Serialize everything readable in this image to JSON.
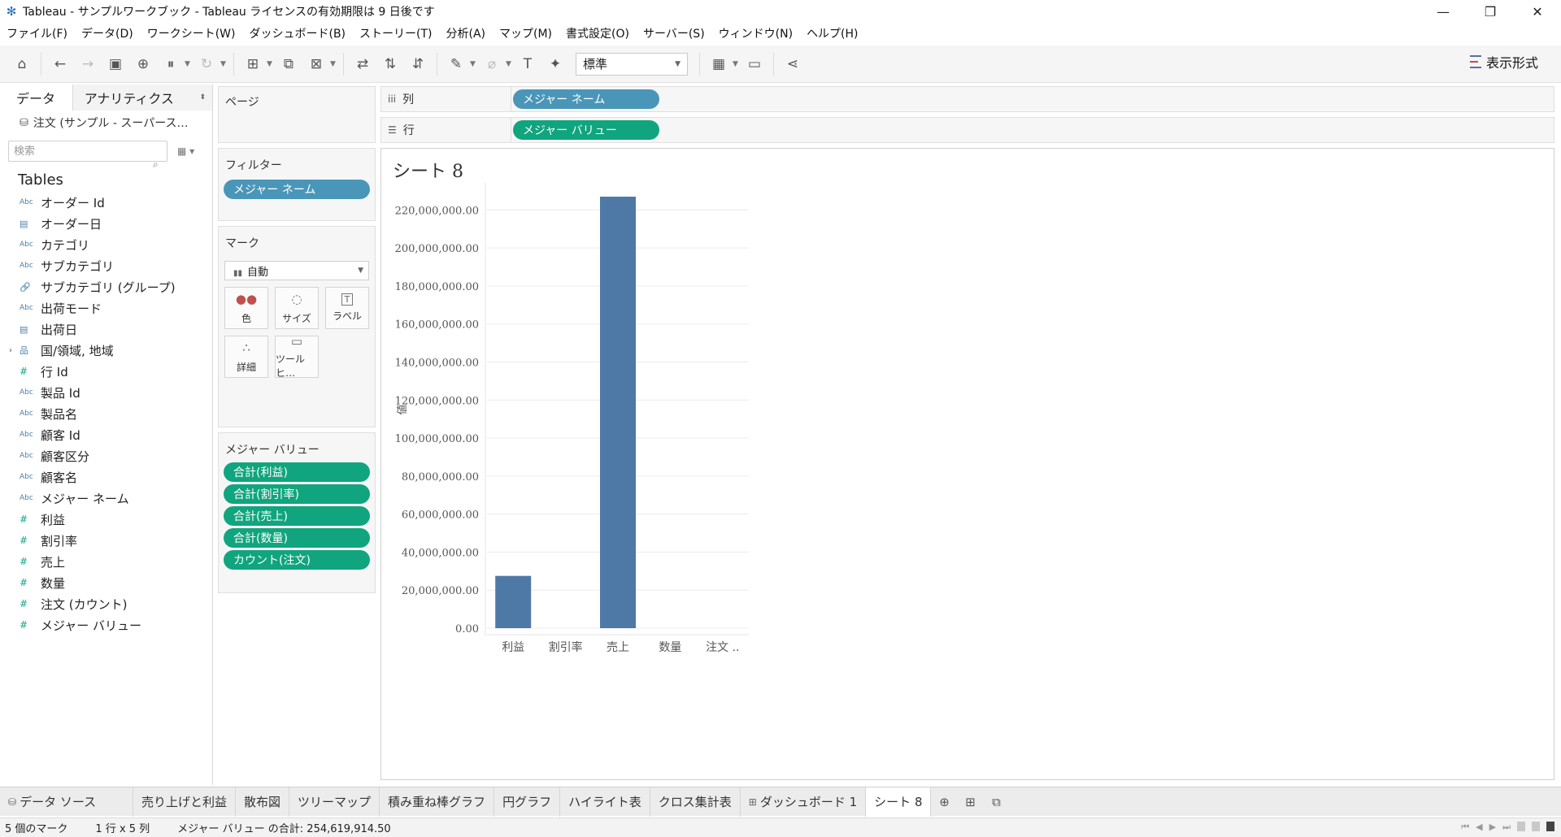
{
  "window": {
    "title": "Tableau - サンプルワークブック - Tableau ライセンスの有効期限は 9 日後です",
    "minimize": "—",
    "restore": "❐",
    "close": "✕"
  },
  "menu": [
    "ファイル(F)",
    "データ(D)",
    "ワークシート(W)",
    "ダッシュボード(B)",
    "ストーリー(T)",
    "分析(A)",
    "マップ(M)",
    "書式設定(O)",
    "サーバー(S)",
    "ウィンドウ(N)",
    "ヘルプ(H)"
  ],
  "toolbar": {
    "fit_value": "標準",
    "show_me_label": "表示形式"
  },
  "data_pane": {
    "tab_data": "データ",
    "tab_analytics": "アナリティクス",
    "datasource": "注文 (サンプル - スーパース…",
    "search_placeholder": "検索",
    "tables_heading": "Tables",
    "fields": [
      {
        "type": "Abc",
        "kind": "str",
        "name": "オーダー Id"
      },
      {
        "type": "▤",
        "kind": "date",
        "name": "オーダー日"
      },
      {
        "type": "Abc",
        "kind": "str",
        "name": "カテゴリ"
      },
      {
        "type": "Abc",
        "kind": "str",
        "name": "サブカテゴリ"
      },
      {
        "type": "🔗",
        "kind": "date",
        "name": "サブカテゴリ (グループ)"
      },
      {
        "type": "Abc",
        "kind": "str",
        "name": "出荷モード"
      },
      {
        "type": "▤",
        "kind": "date",
        "name": "出荷日"
      },
      {
        "type": "品",
        "kind": "date",
        "name": "国/領域, 地域",
        "expander": "›"
      },
      {
        "type": "#",
        "kind": "num",
        "name": "行 Id"
      },
      {
        "type": "Abc",
        "kind": "str",
        "name": "製品 Id"
      },
      {
        "type": "Abc",
        "kind": "str",
        "name": "製品名"
      },
      {
        "type": "Abc",
        "kind": "str",
        "name": "顧客 Id"
      },
      {
        "type": "Abc",
        "kind": "str",
        "name": "顧客区分"
      },
      {
        "type": "Abc",
        "kind": "str",
        "name": "顧客名"
      },
      {
        "type": "Abc",
        "kind": "str",
        "name": "メジャー ネーム"
      },
      {
        "type": "#",
        "kind": "num",
        "name": "利益"
      },
      {
        "type": "#",
        "kind": "num",
        "name": "割引率"
      },
      {
        "type": "#",
        "kind": "num",
        "name": "売上"
      },
      {
        "type": "#",
        "kind": "num",
        "name": "数量"
      },
      {
        "type": "#",
        "kind": "num",
        "name": "注文 (カウント)"
      },
      {
        "type": "#",
        "kind": "num",
        "name": "メジャー バリュー"
      }
    ]
  },
  "shelves": {
    "pages_title": "ページ",
    "filters_title": "フィルター",
    "filter_pill": "メジャー ネーム",
    "marks_title": "マーク",
    "mark_type": "自動",
    "mark_buttons": [
      {
        "icon": "●●",
        "label": "色"
      },
      {
        "icon": "◌",
        "label": "サイズ"
      },
      {
        "icon": "T",
        "label": "ラベル"
      },
      {
        "icon": "∴",
        "label": "詳細"
      },
      {
        "icon": "▭",
        "label": "ツールヒ…"
      }
    ],
    "measure_values_title": "メジャー バリュー",
    "measure_values_pills": [
      "合計(利益)",
      "合計(割引率)",
      "合計(売上)",
      "合計(数量)",
      "カウント(注文)"
    ],
    "columns_label": "列",
    "columns_pill": "メジャー ネーム",
    "rows_label": "行",
    "rows_pill": "メジャー バリュー"
  },
  "view": {
    "sheet_title": "シート 8"
  },
  "chart_data": {
    "type": "bar",
    "categories": [
      "利益",
      "割引率",
      "売上",
      "数量",
      "注文 .."
    ],
    "values": [
      27500000,
      0,
      227000000,
      0,
      0
    ],
    "ylabel": "値",
    "ylim": [
      0,
      230000000
    ],
    "yticks": [
      0,
      20000000,
      40000000,
      60000000,
      80000000,
      100000000,
      120000000,
      140000000,
      160000000,
      180000000,
      200000000,
      220000000
    ],
    "ytick_labels": [
      "0.00",
      "20,000,000.00",
      "40,000,000.00",
      "60,000,000.00",
      "80,000,000.00",
      "100,000,000.00",
      "120,000,000.00",
      "140,000,000.00",
      "160,000,000.00",
      "180,000,000.00",
      "200,000,000.00",
      "220,000,000.00"
    ],
    "grid": true,
    "bar_color": "#4e79a7"
  },
  "sheet_tabs": {
    "datasource_tab": "データ ソース",
    "tabs": [
      "売り上げと利益",
      "散布図",
      "ツリーマップ",
      "積み重ね棒グラフ",
      "円グラフ",
      "ハイライト表",
      "クロス集計表",
      "ダッシュボード 1",
      "シート 8"
    ],
    "active_index": 8
  },
  "status": {
    "marks": "5 個のマーク",
    "dims": "1 行 x 5 列",
    "sum": "メジャー バリュー の合計: 254,619,914.50"
  }
}
